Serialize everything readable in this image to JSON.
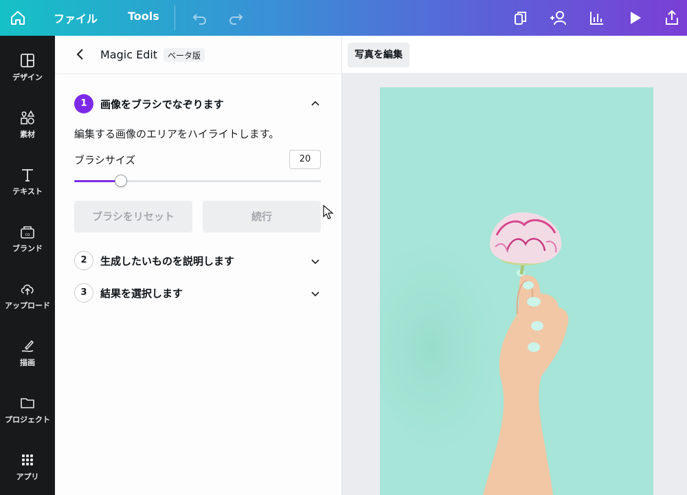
{
  "topbar": {
    "file_label": "ファイル",
    "tools_label": "Tools",
    "icons": [
      "home-icon",
      "undo-icon",
      "redo-icon",
      "resize-icon",
      "share-people-icon",
      "insights-icon",
      "present-icon",
      "upload-share-icon"
    ]
  },
  "rail": {
    "items": [
      {
        "label": "デザイン",
        "icon": "layout-icon"
      },
      {
        "label": "素材",
        "icon": "elements-icon"
      },
      {
        "label": "テキスト",
        "icon": "text-icon"
      },
      {
        "label": "ブランド",
        "icon": "brand-icon"
      },
      {
        "label": "アップロード",
        "icon": "cloud-upload-icon"
      },
      {
        "label": "描画",
        "icon": "draw-icon"
      },
      {
        "label": "プロジェクト",
        "icon": "folder-icon"
      },
      {
        "label": "アプリ",
        "icon": "apps-icon"
      }
    ]
  },
  "panel": {
    "title": "Magic Edit",
    "badge": "ベータ版",
    "steps": [
      {
        "num": "1",
        "title": "画像をブラシでなぞります",
        "expanded": true
      },
      {
        "num": "2",
        "title": "生成したいものを説明します",
        "expanded": false
      },
      {
        "num": "3",
        "title": "結果を選択します",
        "expanded": false
      }
    ],
    "description": "編集する画像のエリアをハイライトします。",
    "brush_size_label": "ブラシサイズ",
    "brush_size_value": "20",
    "brush_slider_fraction": 0.19,
    "reset_button": "ブラシをリセット",
    "continue_button": "続行"
  },
  "canvas": {
    "edit_photo_label": "写真を編集"
  },
  "colors": {
    "accent": "#7d2ae8",
    "photo_bg": "#a6e5d7",
    "rail_bg": "#18191b"
  }
}
